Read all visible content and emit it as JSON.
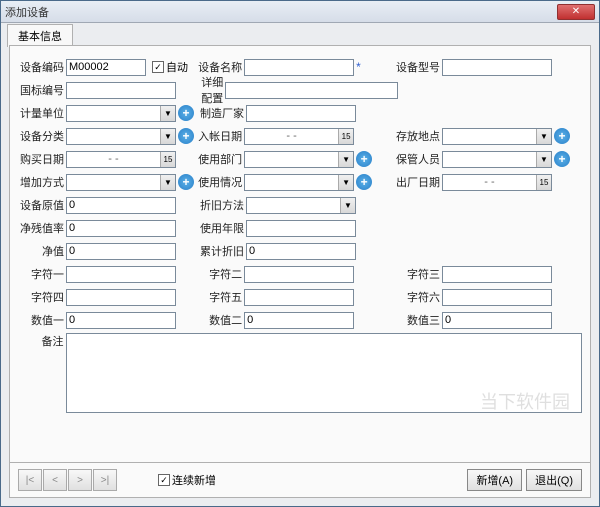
{
  "window": {
    "title": "添加设备"
  },
  "tabs": {
    "basic": "基本信息"
  },
  "labels": {
    "device_code": "设备编码",
    "auto": "自动",
    "device_name": "设备名称",
    "device_model": "设备型号",
    "national_code": "国标编号",
    "detail_config": "详细配置",
    "unit": "计量单位",
    "manufacturer": "制造厂家",
    "device_category": "设备分类",
    "entry_date": "入帐日期",
    "store_location": "存放地点",
    "purchase_date": "购买日期",
    "use_dept": "使用部门",
    "keeper": "保管人员",
    "add_method": "增加方式",
    "use_status": "使用情况",
    "factory_date": "出厂日期",
    "original_value": "设备原值",
    "depreciation_method": "折旧方法",
    "salvage_rate": "净残值率",
    "use_years": "使用年限",
    "net_value": "净值",
    "accum_depreciation": "累计折旧",
    "str1": "字符一",
    "str2": "字符二",
    "str3": "字符三",
    "str4": "字符四",
    "str5": "字符五",
    "str6": "字符六",
    "num1": "数值一",
    "num2": "数值二",
    "num3": "数值三",
    "remark": "备注"
  },
  "values": {
    "device_code": "M00002",
    "auto_checked": "✓",
    "original_value": "0",
    "salvage_rate": "0",
    "net_value": "0",
    "accum_depreciation": "0",
    "num1": "0",
    "num2": "0",
    "num3": "0",
    "date_placeholder": "-  -",
    "continuous_add": "连续新增",
    "continuous_checked": "✓"
  },
  "buttons": {
    "add": "新增(A)",
    "exit": "退出(Q)",
    "nav_first": "|<",
    "nav_prev": "<",
    "nav_next": ">",
    "nav_last": ">|"
  },
  "watermark": "当下软件园"
}
